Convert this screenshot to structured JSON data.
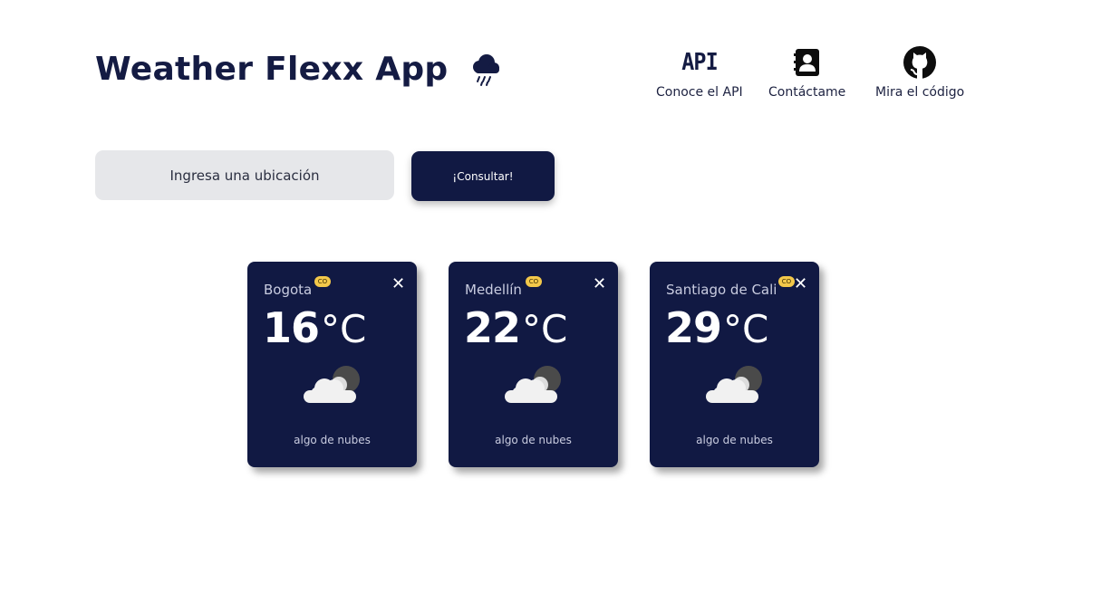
{
  "app": {
    "title": "Weather Flexx App",
    "title_icon": "rain-cloud-icon"
  },
  "nav": {
    "api": {
      "icon_text": "API",
      "label": "Conoce el API",
      "icon": "api-icon"
    },
    "contact": {
      "label": "Contáctame",
      "icon": "contact-book-icon"
    },
    "code": {
      "label": "Mira el código",
      "icon": "github-icon"
    }
  },
  "search": {
    "placeholder": "Ingresa una ubicación",
    "button_label": "¡Consultar!"
  },
  "cards": [
    {
      "city": "Bogota",
      "country": "CO",
      "temp": "16",
      "unit": "°C",
      "description": "algo de nubes",
      "icon": "partly-cloudy-night-icon"
    },
    {
      "city": "Medellín",
      "country": "CO",
      "temp": "22",
      "unit": "°C",
      "description": "algo de nubes",
      "icon": "partly-cloudy-night-icon"
    },
    {
      "city": "Santiago de Cali",
      "country": "CO",
      "temp": "29",
      "unit": "°C",
      "description": "algo de nubes",
      "icon": "partly-cloudy-night-icon"
    }
  ],
  "colors": {
    "primary": "#111943",
    "input_bg": "#e6e7ea",
    "badge": "#f3c84a",
    "background": "#ffffff"
  }
}
